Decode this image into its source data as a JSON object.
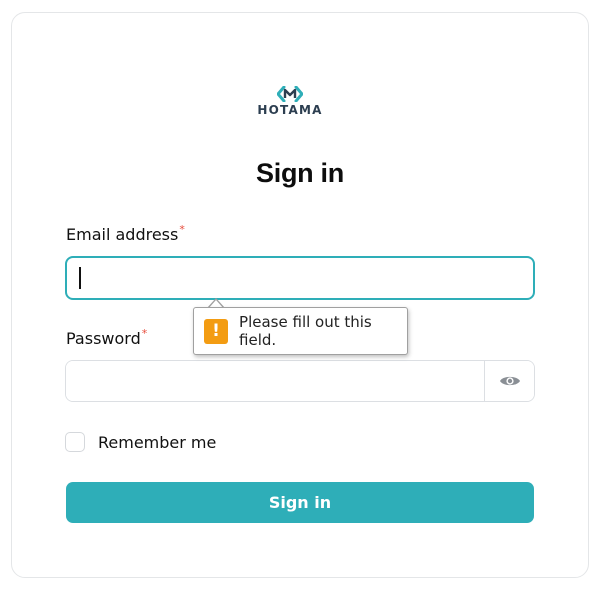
{
  "brand": {
    "name": "HOTAMA",
    "accent": "#2eaeb8"
  },
  "form": {
    "title": "Sign in",
    "email": {
      "label": "Email address",
      "required_mark": "*",
      "value": "",
      "placeholder": ""
    },
    "password": {
      "label": "Password",
      "required_mark": "*",
      "value": "",
      "placeholder": "",
      "toggle_icon": "eye-icon"
    },
    "remember": {
      "label": "Remember me",
      "checked": false
    },
    "submit_label": "Sign in"
  },
  "validation_tooltip": {
    "icon": "warning-icon",
    "icon_glyph": "!",
    "message": "Please fill out this field."
  }
}
